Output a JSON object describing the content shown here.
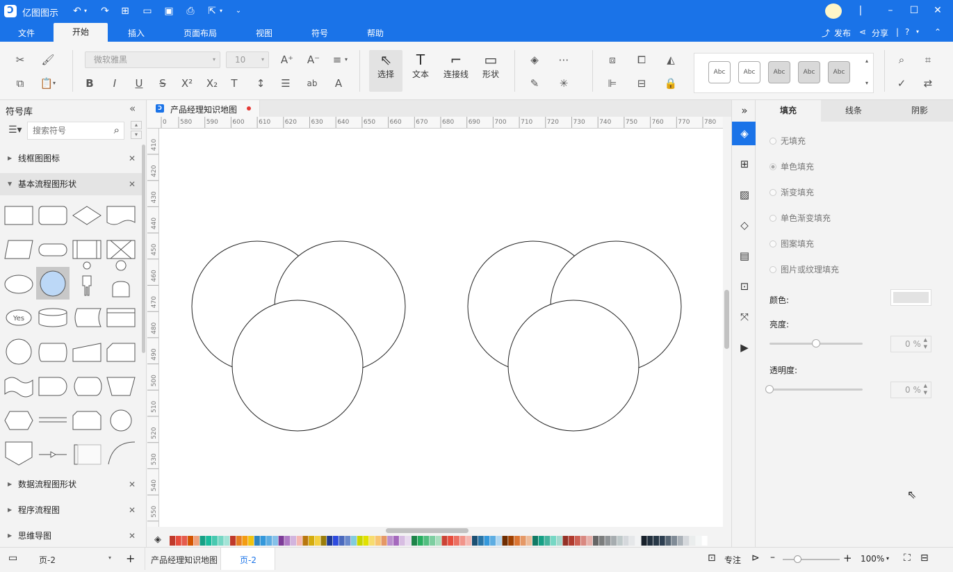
{
  "app": {
    "title": "亿图图示"
  },
  "menu": {
    "items": [
      "文件",
      "开始",
      "插入",
      "页面布局",
      "视图",
      "符号",
      "帮助"
    ],
    "active": "开始",
    "publish": "发布",
    "share": "分享"
  },
  "ribbon": {
    "font_name": "微软雅黑",
    "font_size": "10",
    "tools": {
      "select": "选择",
      "text": "文本",
      "connector": "连接线",
      "shape": "形状"
    },
    "styles": [
      "Abc",
      "Abc",
      "Abc",
      "Abc",
      "Abc"
    ]
  },
  "left_panel": {
    "title": "符号库",
    "search_placeholder": "搜索符号",
    "libraries": [
      {
        "name": "线框图图标",
        "expanded": false
      },
      {
        "name": "基本流程图形状",
        "expanded": true
      },
      {
        "name": "数据流程图形状",
        "expanded": false
      },
      {
        "name": "程序流程图",
        "expanded": false
      },
      {
        "name": "思维导图",
        "expanded": false
      }
    ],
    "yes_shape_label": "Yes"
  },
  "document": {
    "tab_title": "产品经理知识地图",
    "modified": true
  },
  "rulers": {
    "horizontal": [
      "0",
      "580",
      "590",
      "600",
      "610",
      "620",
      "630",
      "640",
      "650",
      "660",
      "670",
      "680",
      "690",
      "700",
      "710",
      "720",
      "730",
      "740",
      "750",
      "760",
      "770",
      "780"
    ],
    "vertical": [
      "410",
      "420",
      "430",
      "440",
      "450",
      "460",
      "470",
      "480",
      "490",
      "500",
      "510",
      "520",
      "530",
      "540",
      "550"
    ]
  },
  "right_panel": {
    "tabs": [
      "填充",
      "线条",
      "阴影"
    ],
    "active_tab": "填充",
    "fill_options": [
      "无填充",
      "单色填充",
      "渐变填充",
      "单色渐变填充",
      "图案填充",
      "图片或纹理填充"
    ],
    "selected_fill": "单色填充",
    "color_label": "颜色:",
    "brightness_label": "亮度:",
    "brightness_value": "0 %",
    "brightness_level": 0.5,
    "transparency_label": "透明度:",
    "transparency_value": "0 %",
    "transparency_level": 0
  },
  "status": {
    "page_select": "页-2",
    "doc_name": "产品经理知识地图",
    "current_page": "页-2",
    "focus": "专注",
    "zoom": "100%"
  },
  "colors": {
    "accent": "#1a73e8",
    "selected_shape_fill": "#bcd8f7",
    "modified_dot": "#e53935"
  }
}
